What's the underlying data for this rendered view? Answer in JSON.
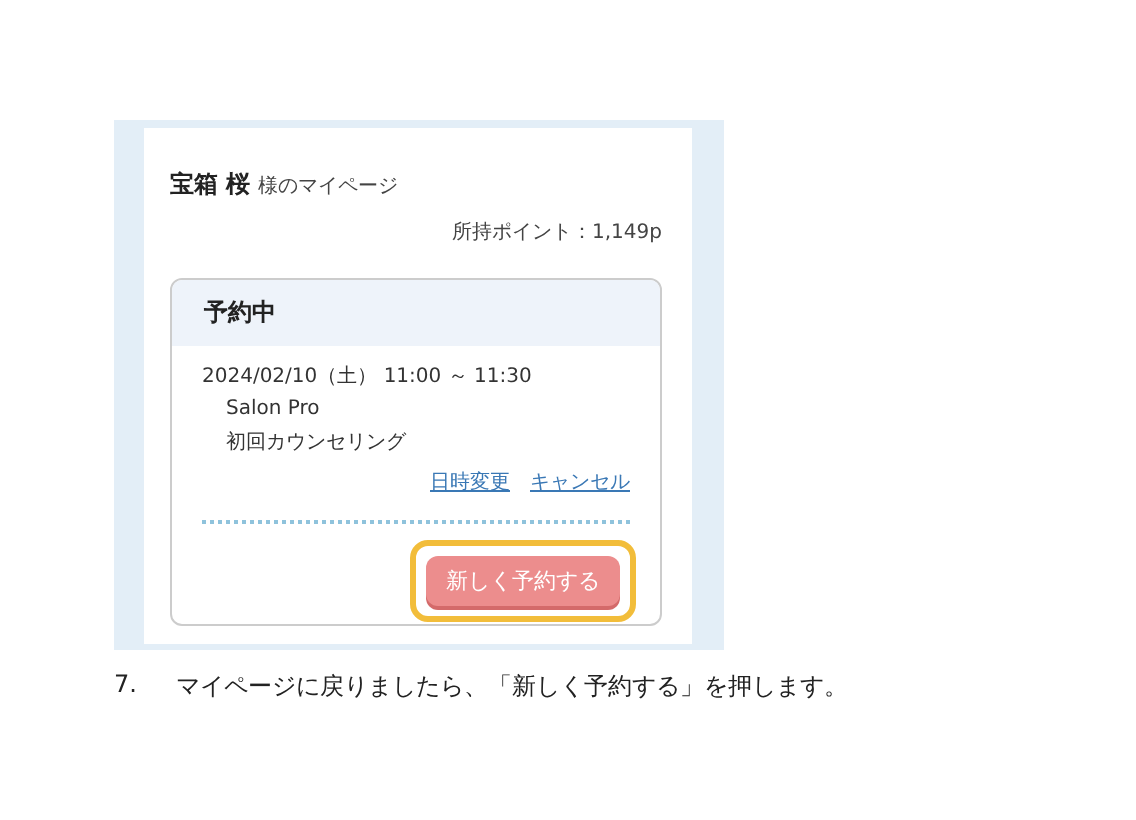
{
  "screenshot": {
    "user_name": "宝箱 桜",
    "page_suffix": "様のマイページ",
    "points": "所持ポイント：1,149p",
    "reservation": {
      "title": "予約中",
      "datetime": "2024/02/10（土） 11:00 ～ 11:30",
      "shop": "Salon Pro",
      "menu": "初回カウンセリング",
      "links": [
        "日時変更",
        "キャンセル"
      ]
    },
    "new_button": {
      "label": "新しく予約する",
      "highlighted": true
    }
  },
  "step": {
    "number": "7.",
    "text": "マイページに戻りましたら、「新しく予約する」を押します。"
  }
}
